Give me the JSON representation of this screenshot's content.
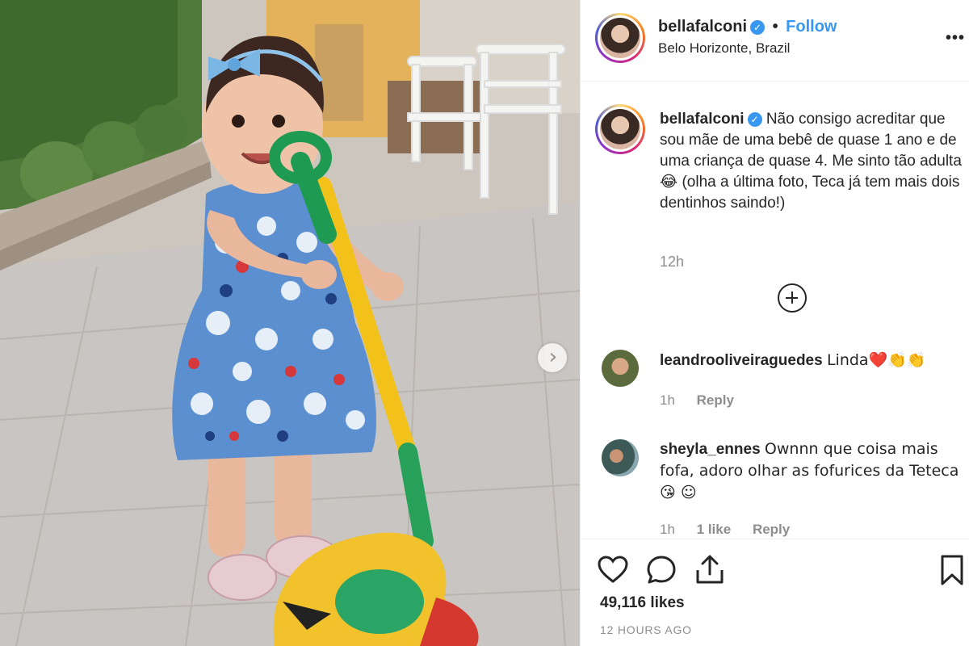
{
  "post": {
    "username": "bellafalconi",
    "verified_mark": "✓",
    "separator": "•",
    "follow_label": "Follow",
    "location": "Belo Horizonte, Brazil",
    "more_label": "•••",
    "next_label": "›",
    "photo_subject_icon": "photo"
  },
  "caption": {
    "username": "bellafalconi",
    "text": "Não consigo acreditar que sou mãe de uma bebê de quase 1 ano e de uma criança de quase 4. Me sinto tão adulta 😂  (olha a última foto, Teca já tem mais dois dentinhos saindo!)",
    "time": "12h"
  },
  "comments": [
    {
      "username": "leandrooliveiraguedes",
      "text": "Linda❤️👏👏",
      "time": "1h",
      "reply_label": "Reply",
      "likes_label": ""
    },
    {
      "username": "sheyla_ennes",
      "text": "Ownnn que coisa mais fofa, adoro olhar as fofurices da Teteca 😘 ☺",
      "time": "1h",
      "likes_label": "1 like",
      "reply_label": "Reply"
    }
  ],
  "footer": {
    "likes": "49,116 likes",
    "time_ago": "12 HOURS AGO"
  },
  "icons": [
    "heart-icon",
    "comment-icon",
    "share-icon",
    "bookmark-icon",
    "plus-circle-icon",
    "chevron-right-icon",
    "verified-icon"
  ],
  "colors": {
    "accent": "#3897f0",
    "text": "#262626",
    "muted": "#8e8e8e",
    "border": "#efefef"
  }
}
